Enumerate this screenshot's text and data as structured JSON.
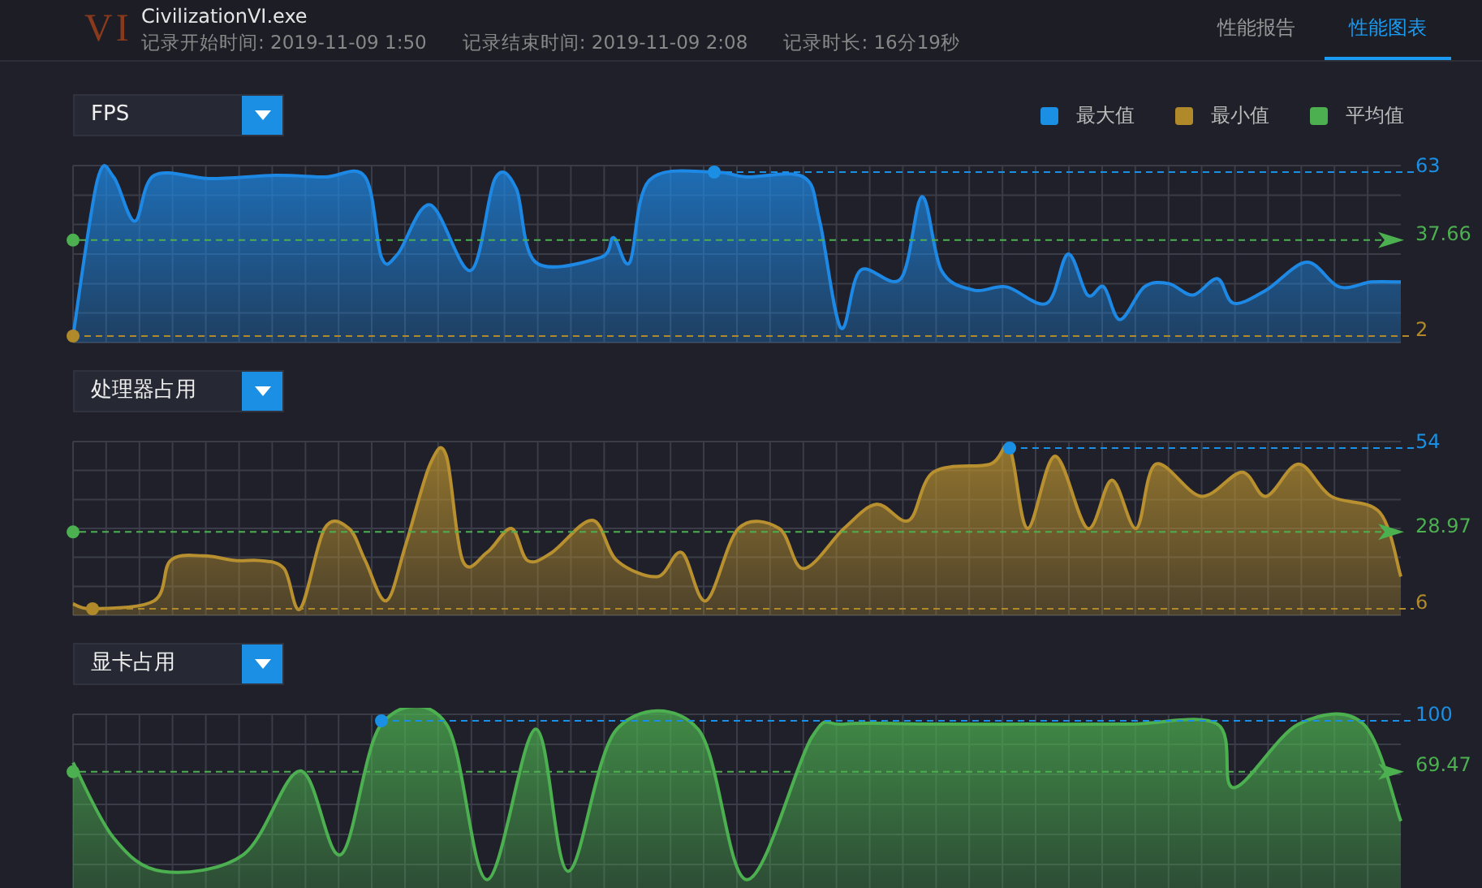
{
  "header": {
    "logo": "VI",
    "title": "CivilizationVI.exe",
    "meta": [
      "记录开始时间: 2019-11-09 1:50",
      "记录结束时间: 2019-11-09 2:08",
      "记录时长: 16分19秒"
    ]
  },
  "tabs": [
    {
      "label": "性能报告",
      "selected": false
    },
    {
      "label": "性能图表",
      "selected": true
    }
  ],
  "legend": [
    {
      "label": "最大值",
      "color": "#1a8fe3"
    },
    {
      "label": "最小值",
      "color": "#b08a2a"
    },
    {
      "label": "平均值",
      "color": "#4caf50"
    }
  ],
  "panels": [
    {
      "selector": "FPS",
      "color": "#1e88e5",
      "max": "63",
      "avg": "37.66",
      "min": "2"
    },
    {
      "selector": "处理器占用",
      "color": "#b8902f",
      "max": "54",
      "avg": "28.97",
      "min": "6"
    },
    {
      "selector": "显卡占用",
      "color": "#4caf50",
      "max": "100",
      "avg": "69.47"
    }
  ]
}
